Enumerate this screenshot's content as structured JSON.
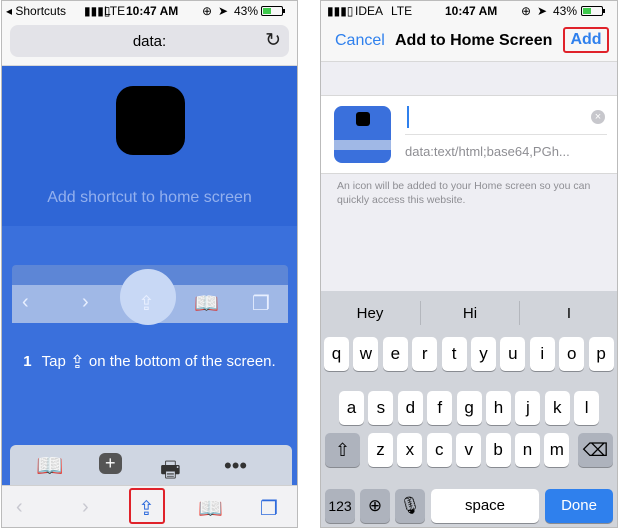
{
  "left": {
    "status": {
      "back_app": "Shortcuts",
      "carrier": "LTE",
      "time": "10:47 AM",
      "battery": "43%",
      "battery_level": 0.43
    },
    "url": "data:",
    "subtitle": "Add shortcut to home screen",
    "step": {
      "number": "1",
      "before": "Tap",
      "after": "on the bottom of the screen."
    },
    "colors": {
      "accent": "#2f66d6",
      "highlight": "#e0222a"
    }
  },
  "right": {
    "status": {
      "carrier": "IDEA",
      "network": "LTE",
      "time": "10:47 AM",
      "battery": "43%",
      "battery_level": 0.43
    },
    "nav": {
      "cancel": "Cancel",
      "title": "Add to Home Screen",
      "add": "Add"
    },
    "url_preview": "data:text/html;base64,PGh...",
    "note": "An icon will be added to your Home screen so you can quickly access this website.",
    "suggestions": [
      "Hey",
      "Hi",
      "I"
    ],
    "rows": [
      [
        "q",
        "w",
        "e",
        "r",
        "t",
        "y",
        "u",
        "i",
        "o",
        "p"
      ],
      [
        "a",
        "s",
        "d",
        "f",
        "g",
        "h",
        "j",
        "k",
        "l"
      ],
      [
        "z",
        "x",
        "c",
        "v",
        "b",
        "n",
        "m"
      ]
    ],
    "keys": {
      "numbers": "123",
      "space": "space",
      "done": "Done"
    }
  }
}
